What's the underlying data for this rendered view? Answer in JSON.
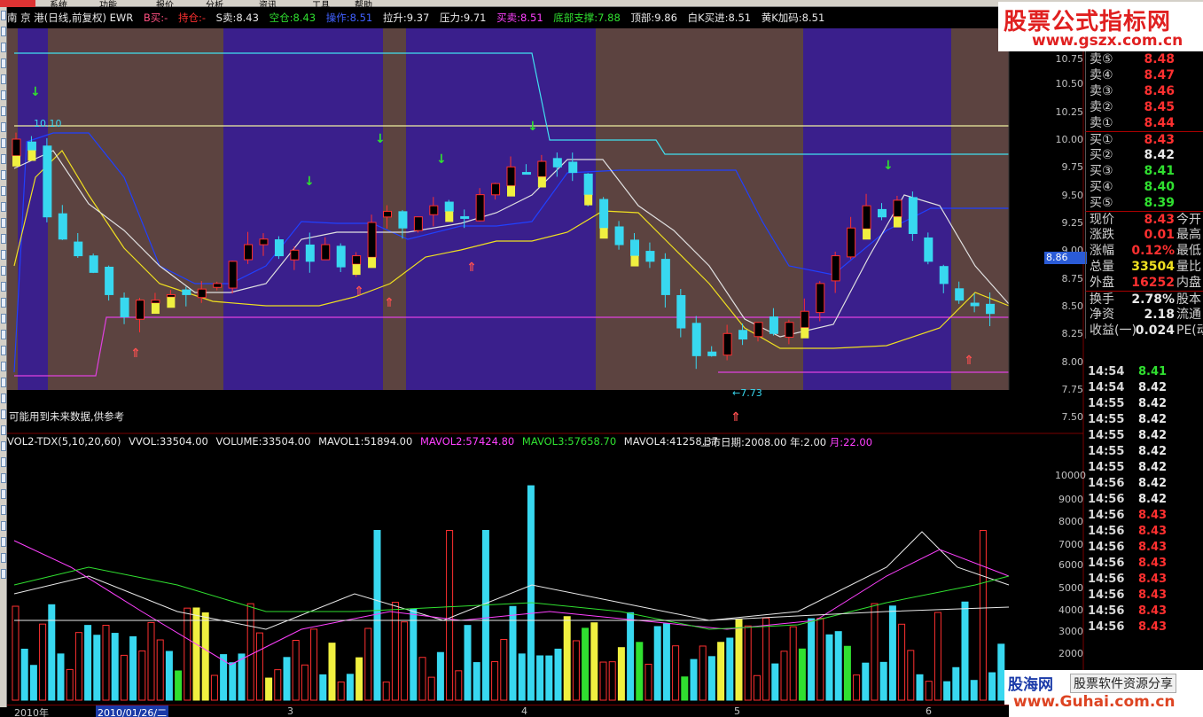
{
  "header": {
    "menu": [
      "系统",
      "功能",
      "报价",
      "分析",
      "资讯",
      "工具",
      "帮助"
    ],
    "stock_title": "南 京 港(日线,前复权) EWR",
    "signal_b": "B买:-",
    "signal_hold": "持仓:-",
    "s_sell": "S卖:8.43",
    "empty_pos": "空仓:8.43",
    "operate": "操作:8.51",
    "pull_up": "拉升:9.37",
    "pressure": "压力:9.71",
    "buy_sell": "买卖:8.51",
    "bottom_support": "底部支撑:7.88",
    "top": "顶部:9.86",
    "white_k": "白K买进:8.51",
    "yellow_k": "黄K加码:8.51"
  },
  "colors": {
    "period_brown": "#5c4340",
    "period_blue": "#3a1f8c",
    "up_candle": "#ff3030",
    "down_candle": "#38d8f0",
    "yellow_candle": "#f0f040",
    "price_red": "#ff3030",
    "price_green": "#30e030",
    "price_white": "#e8e8e8",
    "price_yellow": "#f0e020"
  },
  "chart_annotations": {
    "high_label": "10.10",
    "low_label": "←7.73",
    "warning": "可能用到未来数据,供参考"
  },
  "price_axis": [
    "10.75",
    "10.50",
    "10.25",
    "10.00",
    "9.75",
    "9.50",
    "9.25",
    "9.00",
    "8.75",
    "8.50",
    "8.25",
    "8.00",
    "7.75",
    "7.50"
  ],
  "current_price_tag": "8.86",
  "volume_header": {
    "name": "VOL2-TDX(5,10,20,60)",
    "vvol": "VVOL:33504.00",
    "volume": "VOLUME:33504.00",
    "mavol1": "MAVOL1:51894.00",
    "mavol2": "MAVOL2:57424.80",
    "mavol3": "MAVOL3:57658.70",
    "mavol4": "MAVOL4:41258.37",
    "listing_date": "上市日期:2008.00",
    "year": "年:2.00",
    "month": "月:22.00"
  },
  "volume_axis": [
    "10000",
    "9000",
    "8000",
    "7000",
    "6000",
    "5000",
    "4000",
    "3000",
    "2000"
  ],
  "date_axis": {
    "year": "2010年",
    "current": "2010/01/26/二",
    "m3": "3",
    "m4": "4",
    "m5": "5",
    "m6": "6"
  },
  "quote": {
    "asks": [
      {
        "label": "卖⑤",
        "price": "8.48"
      },
      {
        "label": "卖④",
        "price": "8.47"
      },
      {
        "label": "卖③",
        "price": "8.46"
      },
      {
        "label": "卖②",
        "price": "8.45"
      },
      {
        "label": "卖①",
        "price": "8.44"
      }
    ],
    "bids": [
      {
        "label": "买①",
        "price": "8.43"
      },
      {
        "label": "买②",
        "price": "8.42"
      },
      {
        "label": "买③",
        "price": "8.41"
      },
      {
        "label": "买④",
        "price": "8.40"
      },
      {
        "label": "买⑤",
        "price": "8.39"
      }
    ],
    "stats": [
      {
        "label": "现价",
        "value": "8.43",
        "extra": "今开"
      },
      {
        "label": "涨跌",
        "value": "0.01",
        "extra": "最高"
      },
      {
        "label": "涨幅",
        "value": "0.12%",
        "extra": "最低"
      },
      {
        "label": "总量",
        "value": "33504",
        "extra": "量比"
      },
      {
        "label": "外盘",
        "value": "16252",
        "extra": "内盘"
      }
    ],
    "stats2": [
      {
        "label": "换手",
        "value": "2.78%",
        "extra": "股本"
      },
      {
        "label": "净资",
        "value": "2.18",
        "extra": "流通"
      },
      {
        "label": "收益(一)",
        "value": "0.024",
        "extra": "PE(动"
      }
    ]
  },
  "ticks": [
    {
      "time": "14:54",
      "price": "8.41"
    },
    {
      "time": "14:54",
      "price": "8.42"
    },
    {
      "time": "14:55",
      "price": "8.42"
    },
    {
      "time": "14:55",
      "price": "8.42"
    },
    {
      "time": "14:55",
      "price": "8.42"
    },
    {
      "time": "14:55",
      "price": "8.42"
    },
    {
      "time": "14:55",
      "price": "8.42"
    },
    {
      "time": "14:56",
      "price": "8.42"
    },
    {
      "time": "14:56",
      "price": "8.42"
    },
    {
      "time": "14:56",
      "price": "8.43"
    },
    {
      "time": "14:56",
      "price": "8.43"
    },
    {
      "time": "14:56",
      "price": "8.43"
    },
    {
      "time": "14:56",
      "price": "8.43"
    },
    {
      "time": "14:56",
      "price": "8.43"
    },
    {
      "time": "14:56",
      "price": "8.43"
    },
    {
      "time": "14:56",
      "price": "8.43"
    },
    {
      "time": "14:56",
      "price": "8.43"
    }
  ],
  "site_banner": {
    "title": "股票公式指标网",
    "url": "www.gszx.com.cn"
  },
  "bottom_banner": {
    "name": "股海网",
    "slogan": "股票软件资源分享",
    "url": "www.Guhai.com.cn"
  }
}
